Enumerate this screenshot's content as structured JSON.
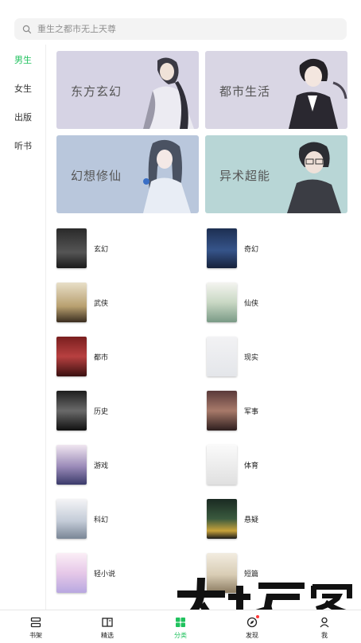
{
  "search": {
    "placeholder": "重生之都市无上天尊"
  },
  "sidebar": {
    "items": [
      {
        "label": "男生",
        "active": true
      },
      {
        "label": "女生",
        "active": false
      },
      {
        "label": "出版",
        "active": false
      },
      {
        "label": "听书",
        "active": false
      }
    ]
  },
  "banners": [
    {
      "label": "东方玄幻"
    },
    {
      "label": "都市生活"
    },
    {
      "label": "幻想修仙"
    },
    {
      "label": "异术超能"
    }
  ],
  "categories": [
    {
      "name": "玄幻"
    },
    {
      "name": "奇幻"
    },
    {
      "name": "武侠"
    },
    {
      "name": "仙侠"
    },
    {
      "name": "都市"
    },
    {
      "name": "现实"
    },
    {
      "name": "历史"
    },
    {
      "name": "军事"
    },
    {
      "name": "游戏"
    },
    {
      "name": "体育"
    },
    {
      "name": "科幻"
    },
    {
      "name": "悬疑"
    },
    {
      "name": "轻小说"
    },
    {
      "name": "短篇"
    }
  ],
  "tabbar": {
    "items": [
      {
        "label": "书架",
        "icon": "bookshelf-icon"
      },
      {
        "label": "精选",
        "icon": "book-open-icon"
      },
      {
        "label": "分类",
        "icon": "category-icon",
        "active": true
      },
      {
        "label": "发现",
        "icon": "discover-icon",
        "badge": true
      },
      {
        "label": "我",
        "icon": "user-icon"
      }
    ]
  },
  "watermark": {
    "text": "大玩家"
  },
  "colors": {
    "accent": "#20c25e",
    "badge": "#ff3b3b"
  }
}
